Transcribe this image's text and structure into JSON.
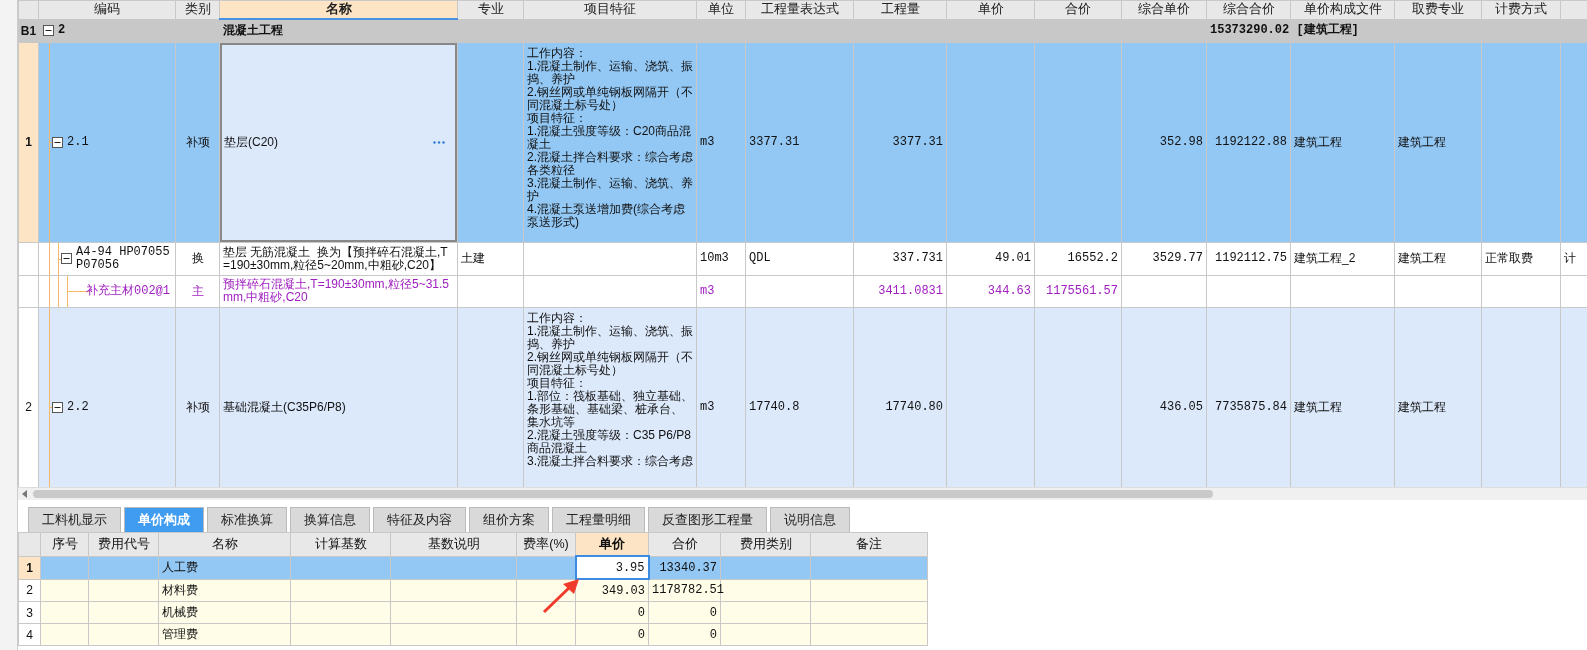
{
  "table": {
    "columns": [
      {
        "label": "编码",
        "selected": false
      },
      {
        "label": "类别",
        "selected": false
      },
      {
        "label": "名称",
        "selected": true
      },
      {
        "label": "专业",
        "selected": false
      },
      {
        "label": "项目特征",
        "selected": false
      },
      {
        "label": "单位",
        "selected": false
      },
      {
        "label": "工程量表达式",
        "selected": false
      },
      {
        "label": "工程量",
        "selected": false
      },
      {
        "label": "单价",
        "selected": false
      },
      {
        "label": "合价",
        "selected": false
      },
      {
        "label": "综合单价",
        "selected": false
      },
      {
        "label": "综合合价",
        "selected": false
      },
      {
        "label": "单价构成文件",
        "selected": false
      },
      {
        "label": "取费专业",
        "selected": false
      },
      {
        "label": "计费方式",
        "selected": false
      }
    ],
    "rows": [
      {
        "kind": "group",
        "row_header": "B1",
        "selected": false,
        "expanded": true,
        "cells": [
          "2",
          null,
          "混凝土工程",
          null,
          null,
          null,
          null,
          null,
          null,
          null,
          null,
          {
            "text": "15373290.02 [建筑工程]",
            "colspan": 2
          },
          null,
          null,
          null
        ],
        "children": [
          {
            "kind": "item",
            "row_header": "1",
            "selected": true,
            "expanded": true,
            "cells": [
              "2.1",
              "补项",
              "垫层(C20)",
              null,
              [
                "工作内容：",
                "1.混凝土制作、运输、浇筑、振捣、养护",
                "2.钢丝网或单纯钢板网隔开（不同混凝土标号处）",
                "项目特征：",
                "1.混凝土强度等级：C20商品混凝土",
                "2.混凝土拌合料要求：综合考虑各类粒径",
                "3.混凝土制作、运输、浇筑、养护",
                "4.混凝土泵送增加费(综合考虑泵送形式)"
              ],
              "m3",
              "3377.31",
              "3377.31",
              null,
              null,
              "352.98",
              "1192122.88",
              "建筑工程",
              "建筑工程",
              null,
              null
            ],
            "children": [
              {
                "kind": "sub",
                "selected": false,
                "expanded": true,
                "cells": [
                  "A4-94 HP07055 P07056",
                  "换",
                  "垫层 无筋混凝土  换为【预拌碎石混凝土,T=190±30mm,粒径5~20mm,中粗砂,C20】",
                  "土建",
                  null,
                  "10m3",
                  "QDL",
                  "337.731",
                  "49.01",
                  "16552.2",
                  "3529.77",
                  "1192112.75",
                  "建筑工程_2",
                  "建筑工程",
                  "正常取费",
                  "计"
                ],
                "children": [
                  {
                    "kind": "material",
                    "selected": false,
                    "cells": [
                      "补充主材002@1",
                      "主",
                      "预拌碎石混凝土,T=190±30mm,粒径5~31.5mm,中粗砂,C20",
                      null,
                      null,
                      "m3",
                      null,
                      "3411.0831",
                      "344.63",
                      "1175561.57",
                      null,
                      null,
                      null,
                      null,
                      null,
                      null
                    ]
                  }
                ]
              }
            ]
          },
          {
            "kind": "item",
            "row_header": "2",
            "selected": false,
            "expanded": true,
            "cells": [
              "2.2",
              "补项",
              "基础混凝土(C35P6/P8)",
              null,
              [
                "工作内容：",
                "1.混凝土制作、运输、浇筑、振捣、养护",
                "2.钢丝网或单纯钢板网隔开（不同混凝土标号处）",
                "项目特征：",
                "1.部位：筏板基础、独立基础、条形基础、基础梁、桩承台、集水坑等",
                "2.混凝土强度等级：C35 P6/P8商品混凝土",
                "3.混凝土拌合料要求：综合考虑"
              ],
              "m3",
              "17740.8",
              "17740.80",
              null,
              null,
              "436.05",
              "7735875.84",
              "建筑工程",
              "建筑工程",
              null,
              null
            ]
          }
        ]
      }
    ]
  },
  "bottom_tabs": [
    {
      "label": "工料机显示",
      "selected": false
    },
    {
      "label": "单价构成",
      "selected": true
    },
    {
      "label": "标准换算",
      "selected": false
    },
    {
      "label": "换算信息",
      "selected": false
    },
    {
      "label": "特征及内容",
      "selected": false
    },
    {
      "label": "组价方案",
      "selected": false
    },
    {
      "label": "工程量明细",
      "selected": false
    },
    {
      "label": "反查图形工程量",
      "selected": false
    },
    {
      "label": "说明信息",
      "selected": false
    }
  ],
  "cost_table": {
    "columns": [
      {
        "label": "序号",
        "selected": false
      },
      {
        "label": "费用代号",
        "selected": false
      },
      {
        "label": "名称",
        "selected": false
      },
      {
        "label": "计算基数",
        "selected": false
      },
      {
        "label": "基数说明",
        "selected": false
      },
      {
        "label": "费率(%)",
        "selected": false
      },
      {
        "label": "单价",
        "selected": true
      },
      {
        "label": "合价",
        "selected": false
      },
      {
        "label": "费用类别",
        "selected": false
      },
      {
        "label": "备注",
        "selected": false
      }
    ],
    "rows": [
      {
        "row_header": "1",
        "selected": true,
        "name": "人工费",
        "unit_price": "3.95",
        "total": "13340.37"
      },
      {
        "row_header": "2",
        "selected": false,
        "name": "材料费",
        "unit_price": "349.03",
        "total": "1178782.51"
      },
      {
        "row_header": "3",
        "selected": false,
        "name": "机械费",
        "unit_price": "0",
        "total": "0"
      },
      {
        "row_header": "4",
        "selected": false,
        "name": "管理费",
        "unit_price": "0",
        "total": "0"
      }
    ]
  }
}
